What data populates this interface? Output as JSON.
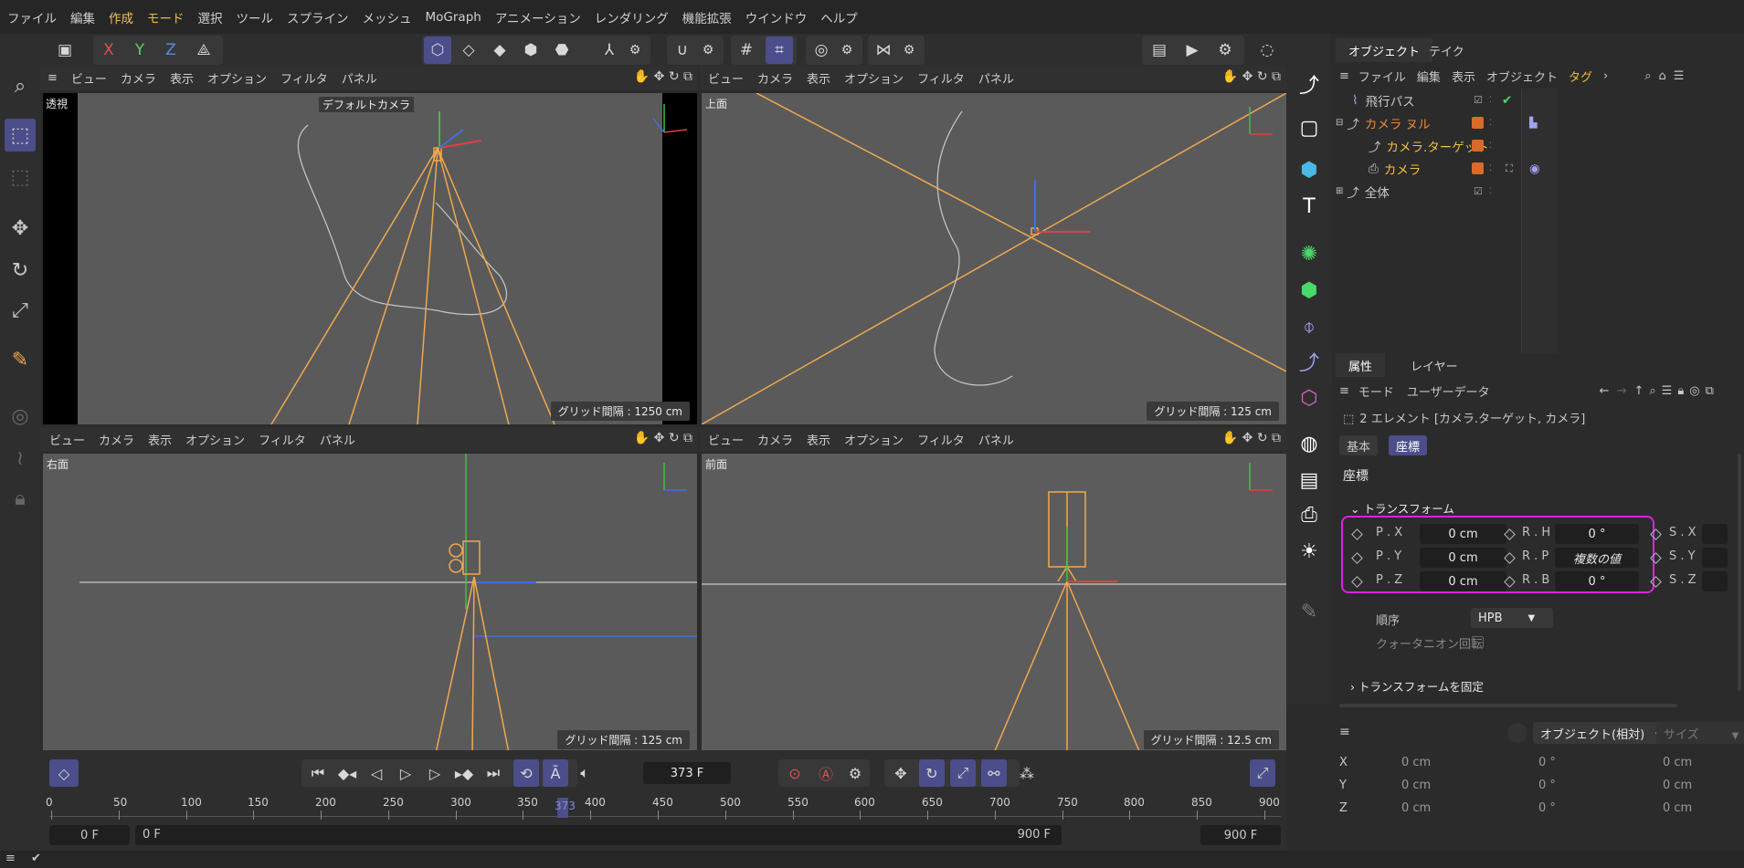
{
  "menu": [
    "ファイル",
    "編集",
    "作成",
    "モード",
    "選択",
    "ツール",
    "スプライン",
    "メッシュ",
    "MoGraph",
    "アニメーション",
    "レンダリング",
    "機能拡張",
    "ウインドウ",
    "ヘルプ"
  ],
  "toolbar": {
    "x": "X",
    "y": "Y",
    "z": "Z"
  },
  "viewport_menu": [
    "ビュー",
    "カメラ",
    "表示",
    "オプション",
    "フィルタ",
    "パネル"
  ],
  "viewports": {
    "perspective": {
      "name": "透視",
      "camera_label": "デフォルトカメラ",
      "grid": "グリッド間隔 : 1250 cm"
    },
    "top": {
      "name": "上面",
      "grid": "グリッド間隔 : 125 cm"
    },
    "right": {
      "name": "右面",
      "grid": "グリッド間隔 : 125 cm"
    },
    "front": {
      "name": "前面",
      "grid": "グリッド間隔 : 12.5 cm"
    }
  },
  "object_manager": {
    "tabs": [
      "オブジェクト",
      "テイク"
    ],
    "menu": [
      "ファイル",
      "編集",
      "表示",
      "オブジェクト",
      "タグ"
    ],
    "objects": [
      {
        "name": "飛行パス",
        "color": "#cfcfcf"
      },
      {
        "name": "カメラ ヌル",
        "color": "#e88a3a"
      },
      {
        "name": "カメラ.ターゲット",
        "color": "#f0c040"
      },
      {
        "name": "カメラ",
        "color": "#f0c040"
      },
      {
        "name": "全体",
        "color": "#cfcfcf"
      }
    ]
  },
  "attributes": {
    "tabs": [
      "属性",
      "レイヤー"
    ],
    "menu": [
      "モード",
      "ユーザーデータ"
    ],
    "selection": "2 エレメント [カメラ.ターゲット, カメラ]",
    "subtabs": [
      "基本",
      "座標"
    ],
    "section": "座標",
    "group": "トランスフォーム",
    "px_label": "P . X",
    "px": "0 cm",
    "py_label": "P . Y",
    "py": "0 cm",
    "pz_label": "P . Z",
    "pz": "0 cm",
    "rh_label": "R . H",
    "rh": "0 °",
    "rp_label": "R . P",
    "rp": "複数の値",
    "rb_label": "R . B",
    "rb": "0 °",
    "sx_label": "S . X",
    "sy_label": "S . Y",
    "sz_label": "S . Z",
    "order_label": "順序",
    "order": "HPB",
    "quat_label": "クォータニオン回転",
    "freeze": "トランスフォームを固定"
  },
  "coord_manager": {
    "mode": "オブジェクト(相対)",
    "size": "サイズ",
    "rows": [
      {
        "axis": "X",
        "pos": "0 cm",
        "rot": "0 °",
        "size": "0 cm"
      },
      {
        "axis": "Y",
        "pos": "0 cm",
        "rot": "0 °",
        "size": "0 cm"
      },
      {
        "axis": "Z",
        "pos": "0 cm",
        "rot": "0 °",
        "size": "0 cm"
      }
    ]
  },
  "timeline": {
    "current_frame": "373 F",
    "ruler": [
      "0",
      "50",
      "100",
      "150",
      "200",
      "250",
      "300",
      "350",
      "400",
      "450",
      "500",
      "550",
      "600",
      "650",
      "700",
      "750",
      "800",
      "850",
      "900"
    ],
    "playhead": "373",
    "start": "0 F",
    "range_start": "0 F",
    "range_end": "900 F",
    "end": "900 F"
  },
  "colors": {
    "accent": "#4b4e8a",
    "highlight_box": "#e020e0",
    "camera_orange": "#f0a850"
  }
}
